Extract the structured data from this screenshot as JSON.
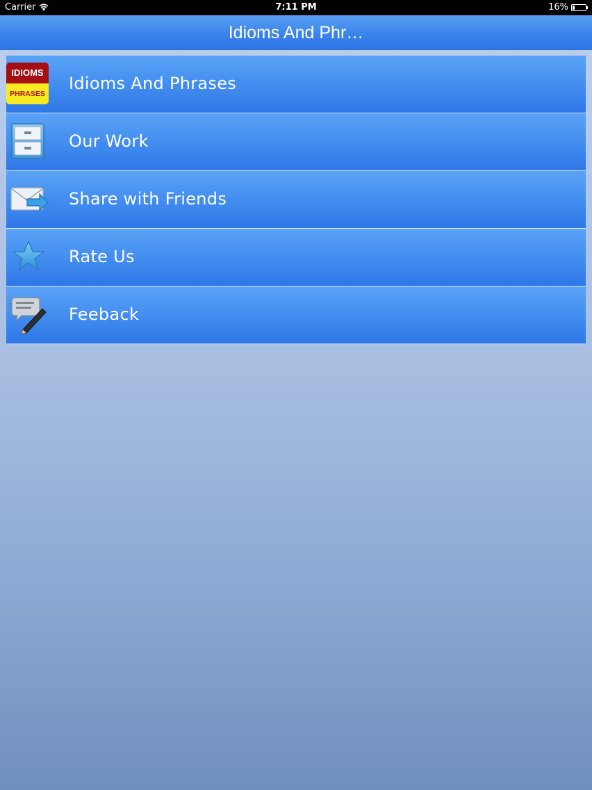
{
  "status_bar": {
    "carrier": "Carrier",
    "time": "7:11 PM",
    "battery": "16%",
    "battery_level": 0.16
  },
  "nav": {
    "title": "Idioms And Phr…"
  },
  "menu": {
    "items": [
      {
        "label": "Idioms And Phrases",
        "icon": "idioms-phrases-logo-icon"
      },
      {
        "label": "Our Work",
        "icon": "cabinet-icon"
      },
      {
        "label": "Share with Friends",
        "icon": "mail-share-icon"
      },
      {
        "label": "Rate Us",
        "icon": "star-icon"
      },
      {
        "label": "Feeback",
        "icon": "feedback-chat-pen-icon"
      }
    ]
  },
  "logo": {
    "top_text": "IDIOMS",
    "bottom_text": "PHRASES"
  },
  "colors": {
    "nav_blue": "#3b84ec",
    "row_blue": "#4590f0",
    "logo_red": "#a30f12",
    "logo_yellow": "#f7ea21"
  }
}
